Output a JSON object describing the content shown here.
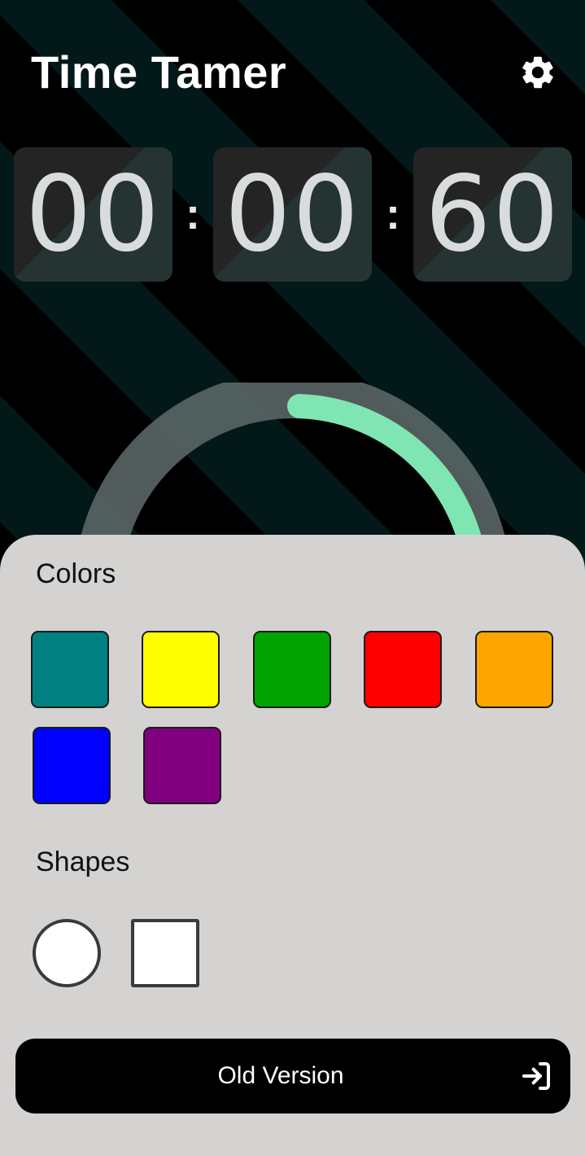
{
  "app": {
    "title": "Time Tamer"
  },
  "header": {
    "settings_icon": "gear-icon"
  },
  "timer": {
    "hours": "00",
    "minutes": "00",
    "seconds": "60",
    "separator": ":",
    "progress_fraction": 0.25,
    "progress_color": "#7fe5b3",
    "track_color": "#5f6b6b"
  },
  "panel": {
    "colors_title": "Colors",
    "colors": [
      {
        "name": "teal",
        "hex": "#008080"
      },
      {
        "name": "yellow",
        "hex": "#ffff00"
      },
      {
        "name": "green",
        "hex": "#00a300"
      },
      {
        "name": "red",
        "hex": "#ff0000"
      },
      {
        "name": "orange",
        "hex": "#ffa500"
      },
      {
        "name": "blue",
        "hex": "#0000ff"
      },
      {
        "name": "purple",
        "hex": "#800080"
      }
    ],
    "shapes_title": "Shapes",
    "shapes": [
      "circle",
      "square"
    ]
  },
  "old_version": {
    "label": "Old Version",
    "icon": "login-arrow-icon"
  }
}
